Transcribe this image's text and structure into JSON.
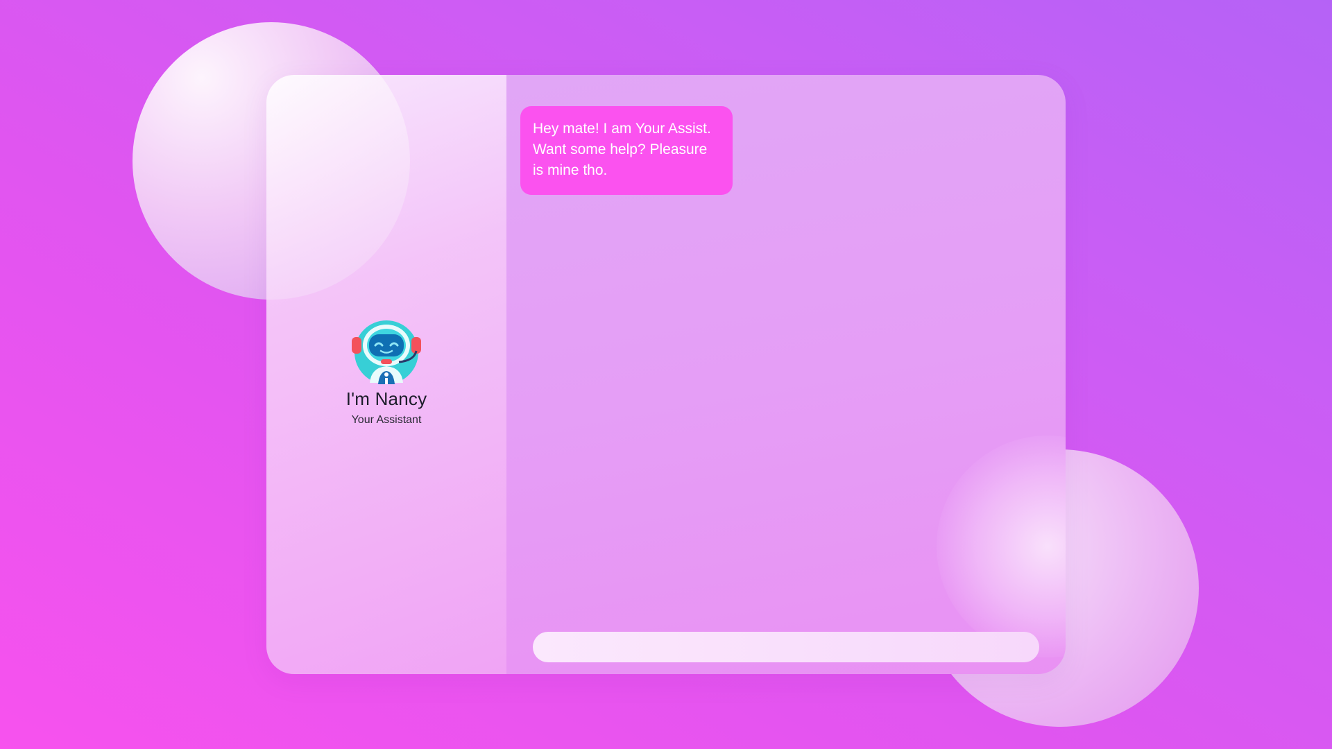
{
  "assistant": {
    "name": "I'm Nancy",
    "role": "Your Assistant",
    "avatar_icon": "robot-headset-icon"
  },
  "chat": {
    "messages": [
      {
        "sender": "assistant",
        "text": "Hey mate! I am Your Assist. Want some help? Pleasure is mine tho."
      }
    ],
    "input": {
      "value": "",
      "placeholder": ""
    }
  },
  "colors": {
    "bubble": "#fb52ef",
    "background_start": "#f752ee",
    "background_end": "#b562f6"
  }
}
